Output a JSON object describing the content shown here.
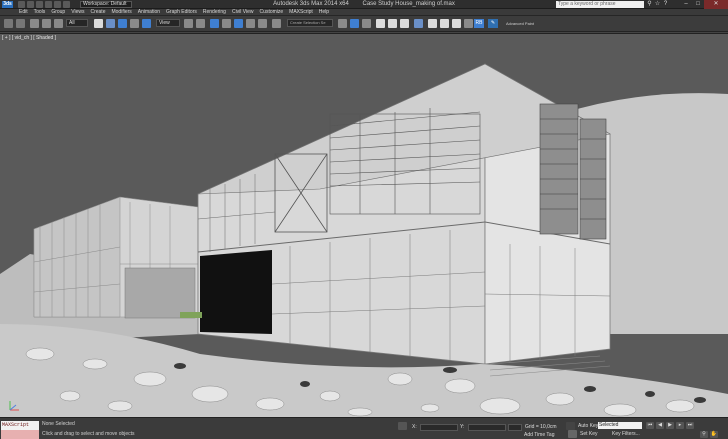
{
  "titlebar": {
    "logo": "3ds",
    "workspace": "Workspace: Default",
    "app_title": "Autodesk 3ds Max  2014 x64",
    "file_title": "Case Study House_making of.max",
    "search_placeholder": "Type a keyword or phrase"
  },
  "menu": {
    "items": [
      "Edit",
      "Tools",
      "Group",
      "Views",
      "Create",
      "Modifiers",
      "Animation",
      "Graph Editors",
      "Rendering",
      "Civil View",
      "Customize",
      "MAXScript",
      "Help"
    ]
  },
  "toolbar": {
    "selection_set": "All",
    "reference_coord": "View",
    "named_selection": "Create Selection Se",
    "advanced_label": "Advanced Paint"
  },
  "viewport": {
    "label": "[ + ] [ vid_ch ] [ Shaded ]"
  },
  "status": {
    "maxscript_label": "MAXScript Mini",
    "selection_status": "None Selected",
    "prompt": "Click and drag to select and move objects",
    "x_label": "X:",
    "y_label": "Y:",
    "z_label": "Z:",
    "grid": "Grid = 10,0cm",
    "add_time_tag": "Add Time Tag",
    "auto_key": "Auto Key",
    "selected": "Selected",
    "set_key": "Set Key",
    "key_filters": "Key Filters..."
  },
  "colors": {
    "sky": "#5a5a5a",
    "building": "#d9d9d9",
    "ground": "#b9b9b9",
    "accent_blue": "#2a6fbd"
  }
}
